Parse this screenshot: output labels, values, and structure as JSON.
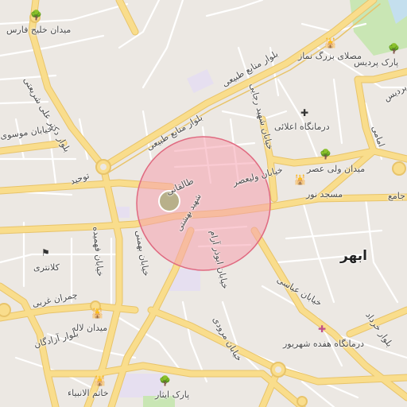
{
  "map": {
    "city_label": "ابهر",
    "labels": {
      "meydan_khalij_fars": "میدان خلیج فارس",
      "bolvar_dr_ali_shariati": "بلوار دکتر علی شریعتی",
      "bolvar_manabe_tabiei_top": "بلوار منابع طبیعی",
      "bolvar_manabe_tabiei_mid": "بلوار منابع طبیعی",
      "mosalla": "مصلای بزرگ نماز",
      "park_pardis": "پارک پردیس",
      "bolvar_pardis": "بلوار پردیس",
      "khiaban_mousavi": "خیابان موسوی",
      "towhid": "توحید",
      "shahid_rajaee": "خیابان شهید رجایی",
      "darmangah_alalati": "درمانگاه اعلائی",
      "emami": "امامی",
      "meydan_vali_asr": "میدان ولی عصر",
      "khiaban_vali_asr": "خیابان ولیعصر",
      "masjed_nour": "مسجد نور",
      "jame": "جامع",
      "taleghani": "طالقانی",
      "shahid_beheshti": "شهید بهشتی",
      "khiaban_fahmideh": "خیابان فهمیده",
      "khiaban_bahmani": "خیابان بهمنی",
      "khiaban_abouzar": "خیابان ابوذر آرام",
      "khiaban_abbasi": "خیابان عباسی",
      "kalantari": "کلانتری",
      "chamran_gharbi": "چمران غربی",
      "meydan_laleh": "میدان لاله",
      "bolvar_azadegan": "بلوار آزادگان",
      "khiaban_maroodi": "خیابان مرودی",
      "darmangah_hefdah": "درمانگاه هفده شهریور",
      "bolvar_khordad": "بلوار خرداد",
      "khatam_anbia": "خاتم الانبیاء",
      "park_isar": "پارک ایثار"
    },
    "icons": {
      "mosque": "mosque-icon",
      "hospital": "hospital-cross-icon",
      "tree": "tree-icon",
      "police": "police-icon"
    },
    "colors": {
      "land": "#ece8e3",
      "major_road": "#f9dd8c",
      "road_outline": "#e8c46a",
      "minor_road": "#ffffff",
      "park": "#c9e6b4",
      "highlight_fill": "#f5a0ae",
      "highlight_stroke": "#e06a80",
      "marker": "#b8b08a"
    }
  }
}
